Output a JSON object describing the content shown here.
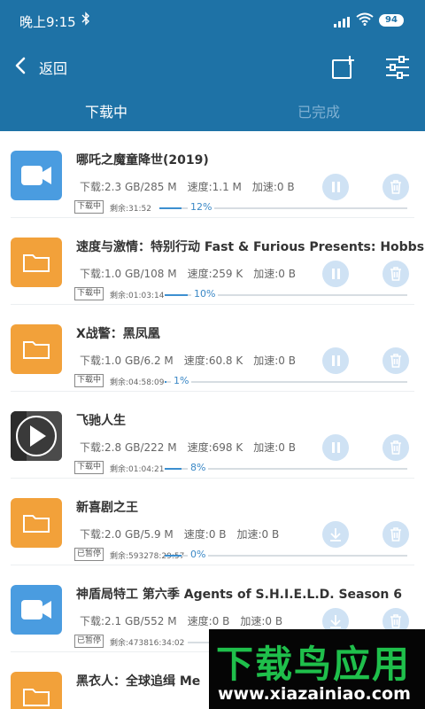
{
  "status_bar": {
    "time": "晚上9:15",
    "battery": "94"
  },
  "topbar": {
    "back_label": "返回"
  },
  "tabs": [
    {
      "label": "下载中"
    },
    {
      "label": "已完成"
    }
  ],
  "items": [
    {
      "thumb": "video-icon",
      "title": "哪吒之魔童降世(2019)",
      "downloaded": "下载:2.3 GB/285 M",
      "speed": "速度:1.1 M",
      "boost": "加速:0 B",
      "status": "下载中",
      "remaining": "剩余:31:52",
      "progress_text": "12%",
      "progress": 12,
      "action": "pause-icon"
    },
    {
      "thumb": "folder-icon",
      "title": "速度与激情：特别行动 Fast & Furious Presents: Hobbs",
      "downloaded": "下载:1.0 GB/108 M",
      "speed": "速度:259 K",
      "boost": "加速:0 B",
      "status": "下载中",
      "remaining": "剩余:01:03:14",
      "progress_text": "10%",
      "progress": 10,
      "action": "pause-icon"
    },
    {
      "thumb": "folder-icon",
      "title": "X战警：黑凤凰",
      "downloaded": "下载:1.0 GB/6.2 M",
      "speed": "速度:60.8 K",
      "boost": "加速:0 B",
      "status": "下载中",
      "remaining": "剩余:04:58:09",
      "progress_text": "1%",
      "progress": 1,
      "action": "pause-icon"
    },
    {
      "thumb": "play-thumbnail",
      "title": "飞驰人生",
      "downloaded": "下载:2.8 GB/222 M",
      "speed": "速度:698 K",
      "boost": "加速:0 B",
      "status": "下载中",
      "remaining": "剩余:01:04:21",
      "progress_text": "8%",
      "progress": 8,
      "action": "pause-icon"
    },
    {
      "thumb": "folder-icon",
      "title": "新喜剧之王",
      "downloaded": "下载:2.0 GB/5.9 M",
      "speed": "速度:0 B",
      "boost": "加速:0 B",
      "status": "已暂停",
      "remaining": "剩余:593278:29:57",
      "progress_text": "0%",
      "progress": 0,
      "action": "download-icon"
    },
    {
      "thumb": "video-icon",
      "title": "神盾局特工 第六季 Agents of S.H.I.E.L.D. Season 6",
      "downloaded": "下载:2.1 GB/552 M",
      "speed": "速度:0 B",
      "boost": "加速:0 B",
      "status": "已暂停",
      "remaining": "剩余:473816:34:02",
      "progress_text": "",
      "progress": 0,
      "action": "download-icon"
    },
    {
      "thumb": "folder-icon",
      "title": "黑衣人：全球追缉 Me",
      "downloaded": "",
      "speed": "",
      "boost": "",
      "status": "",
      "remaining": "",
      "progress_text": "",
      "progress": 0,
      "action": ""
    }
  ],
  "watermark": {
    "title": "下载鸟应用",
    "url": "www.xiazainiao.com"
  },
  "colors": {
    "header": "#1e72a6",
    "accent": "#3c8fd0",
    "folder": "#f2a13a",
    "video": "#4a9ce0",
    "button": "#cfe2f4"
  }
}
